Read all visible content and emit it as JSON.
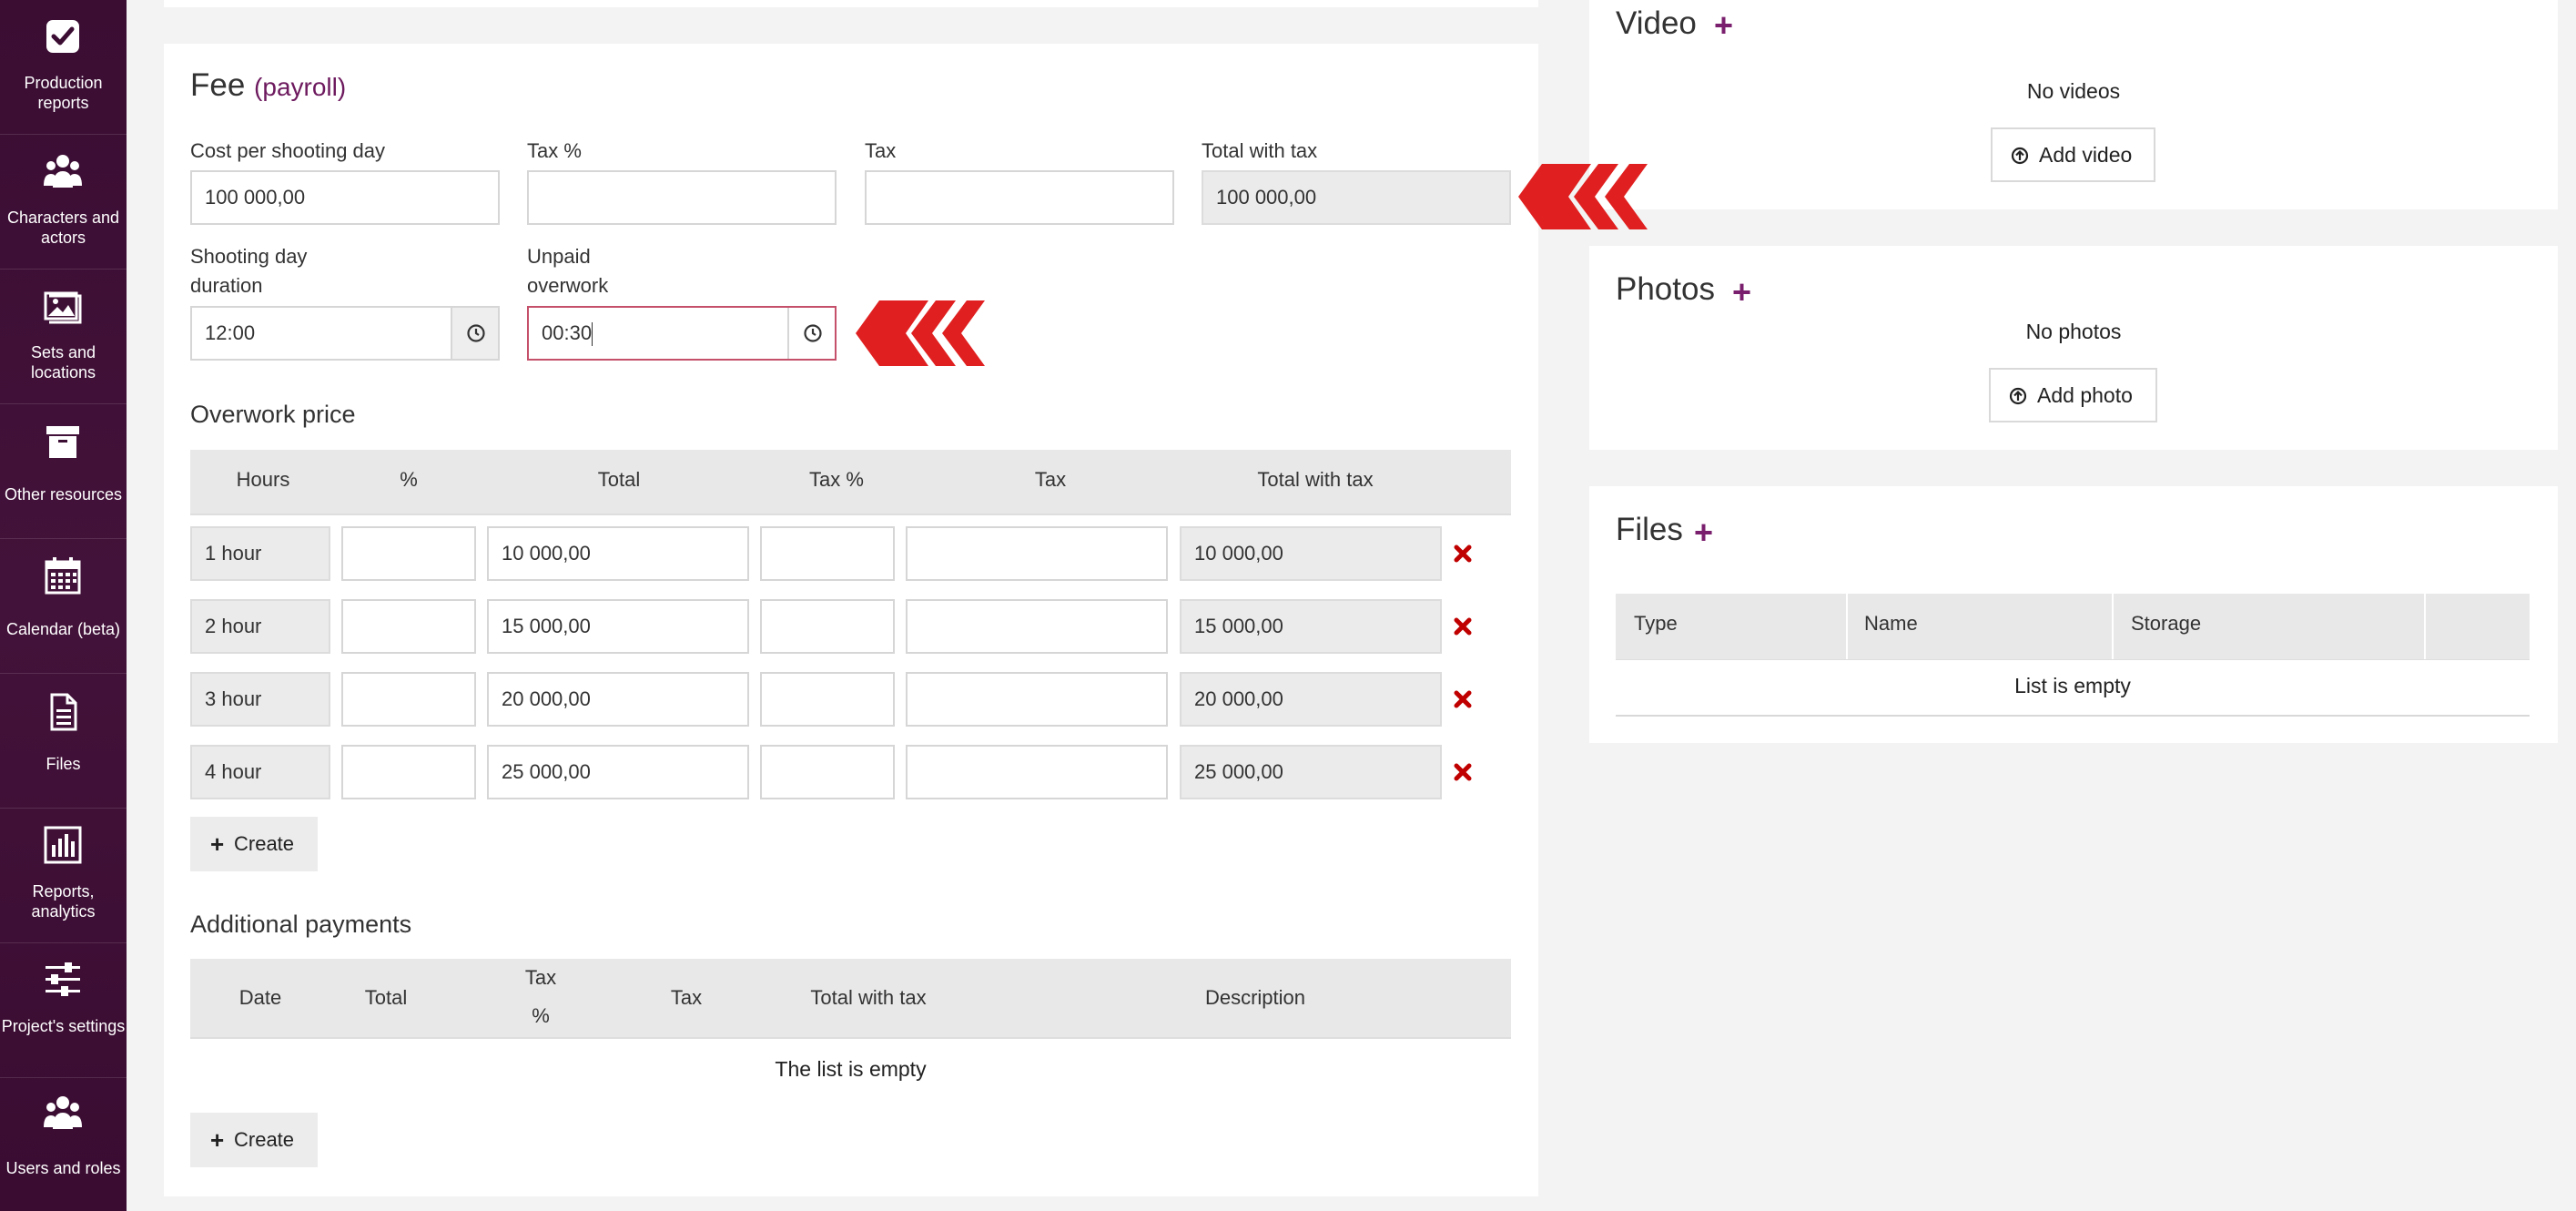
{
  "sidebar": {
    "items": [
      {
        "icon": "checkbox-icon",
        "label": "Production reports"
      },
      {
        "icon": "people-icon",
        "label": "Characters and actors"
      },
      {
        "icon": "image-icon",
        "label": "Sets and locations"
      },
      {
        "icon": "archive-box-icon",
        "label": "Other resources"
      },
      {
        "icon": "calendar-icon",
        "label": "Calendar (beta)"
      },
      {
        "icon": "file-icon",
        "label": "Files"
      },
      {
        "icon": "bar-chart-icon",
        "label": "Reports, analytics"
      },
      {
        "icon": "sliders-icon",
        "label": "Project's settings"
      },
      {
        "icon": "users-icon",
        "label": "Users and roles"
      }
    ]
  },
  "fee": {
    "title": "Fee",
    "subtitle": "(payroll)",
    "fields": {
      "cost_label": "Cost per shooting day",
      "cost_value": "100 000,00",
      "taxpct_label": "Tax %",
      "taxpct_value": "",
      "tax_label": "Tax",
      "tax_value": "",
      "total_label": "Total with tax",
      "total_value": "100 000,00",
      "duration_label_1": "Shooting day",
      "duration_label_2": "duration",
      "duration_value": "12:00",
      "unpaid_label_1": "Unpaid",
      "unpaid_label_2": "overwork",
      "unpaid_value": "00:30"
    }
  },
  "overwork": {
    "title": "Overwork price",
    "headers": [
      "Hours",
      "%",
      "Total",
      "Tax %",
      "Tax",
      "Total with tax"
    ],
    "rows": [
      {
        "hours": "1 hour",
        "pct": "",
        "total": "10 000,00",
        "taxpct": "",
        "tax": "",
        "total_with_tax": "10 000,00"
      },
      {
        "hours": "2 hour",
        "pct": "",
        "total": "15 000,00",
        "taxpct": "",
        "tax": "",
        "total_with_tax": "15 000,00"
      },
      {
        "hours": "3 hour",
        "pct": "",
        "total": "20 000,00",
        "taxpct": "",
        "tax": "",
        "total_with_tax": "20 000,00"
      },
      {
        "hours": "4 hour",
        "pct": "",
        "total": "25 000,00",
        "taxpct": "",
        "tax": "",
        "total_with_tax": "25 000,00"
      }
    ],
    "create_label": "Create"
  },
  "additional": {
    "title": "Additional payments",
    "headers": [
      "Date",
      "Total",
      "Tax",
      "%",
      "Tax",
      "Total with tax",
      "Description"
    ],
    "empty": "The list is empty",
    "create_label": "Create"
  },
  "video": {
    "title": "Video",
    "empty": "No videos",
    "button": "Add video"
  },
  "photos": {
    "title": "Photos",
    "empty": "No photos",
    "button": "Add photo"
  },
  "files": {
    "title": "Files",
    "headers": [
      "Type",
      "Name",
      "Storage"
    ],
    "empty": "List is empty"
  },
  "colors": {
    "accent": "#6d1a5e",
    "sidebar": "#3b0d33",
    "delete": "#c00000",
    "arrow": "#e02020"
  }
}
